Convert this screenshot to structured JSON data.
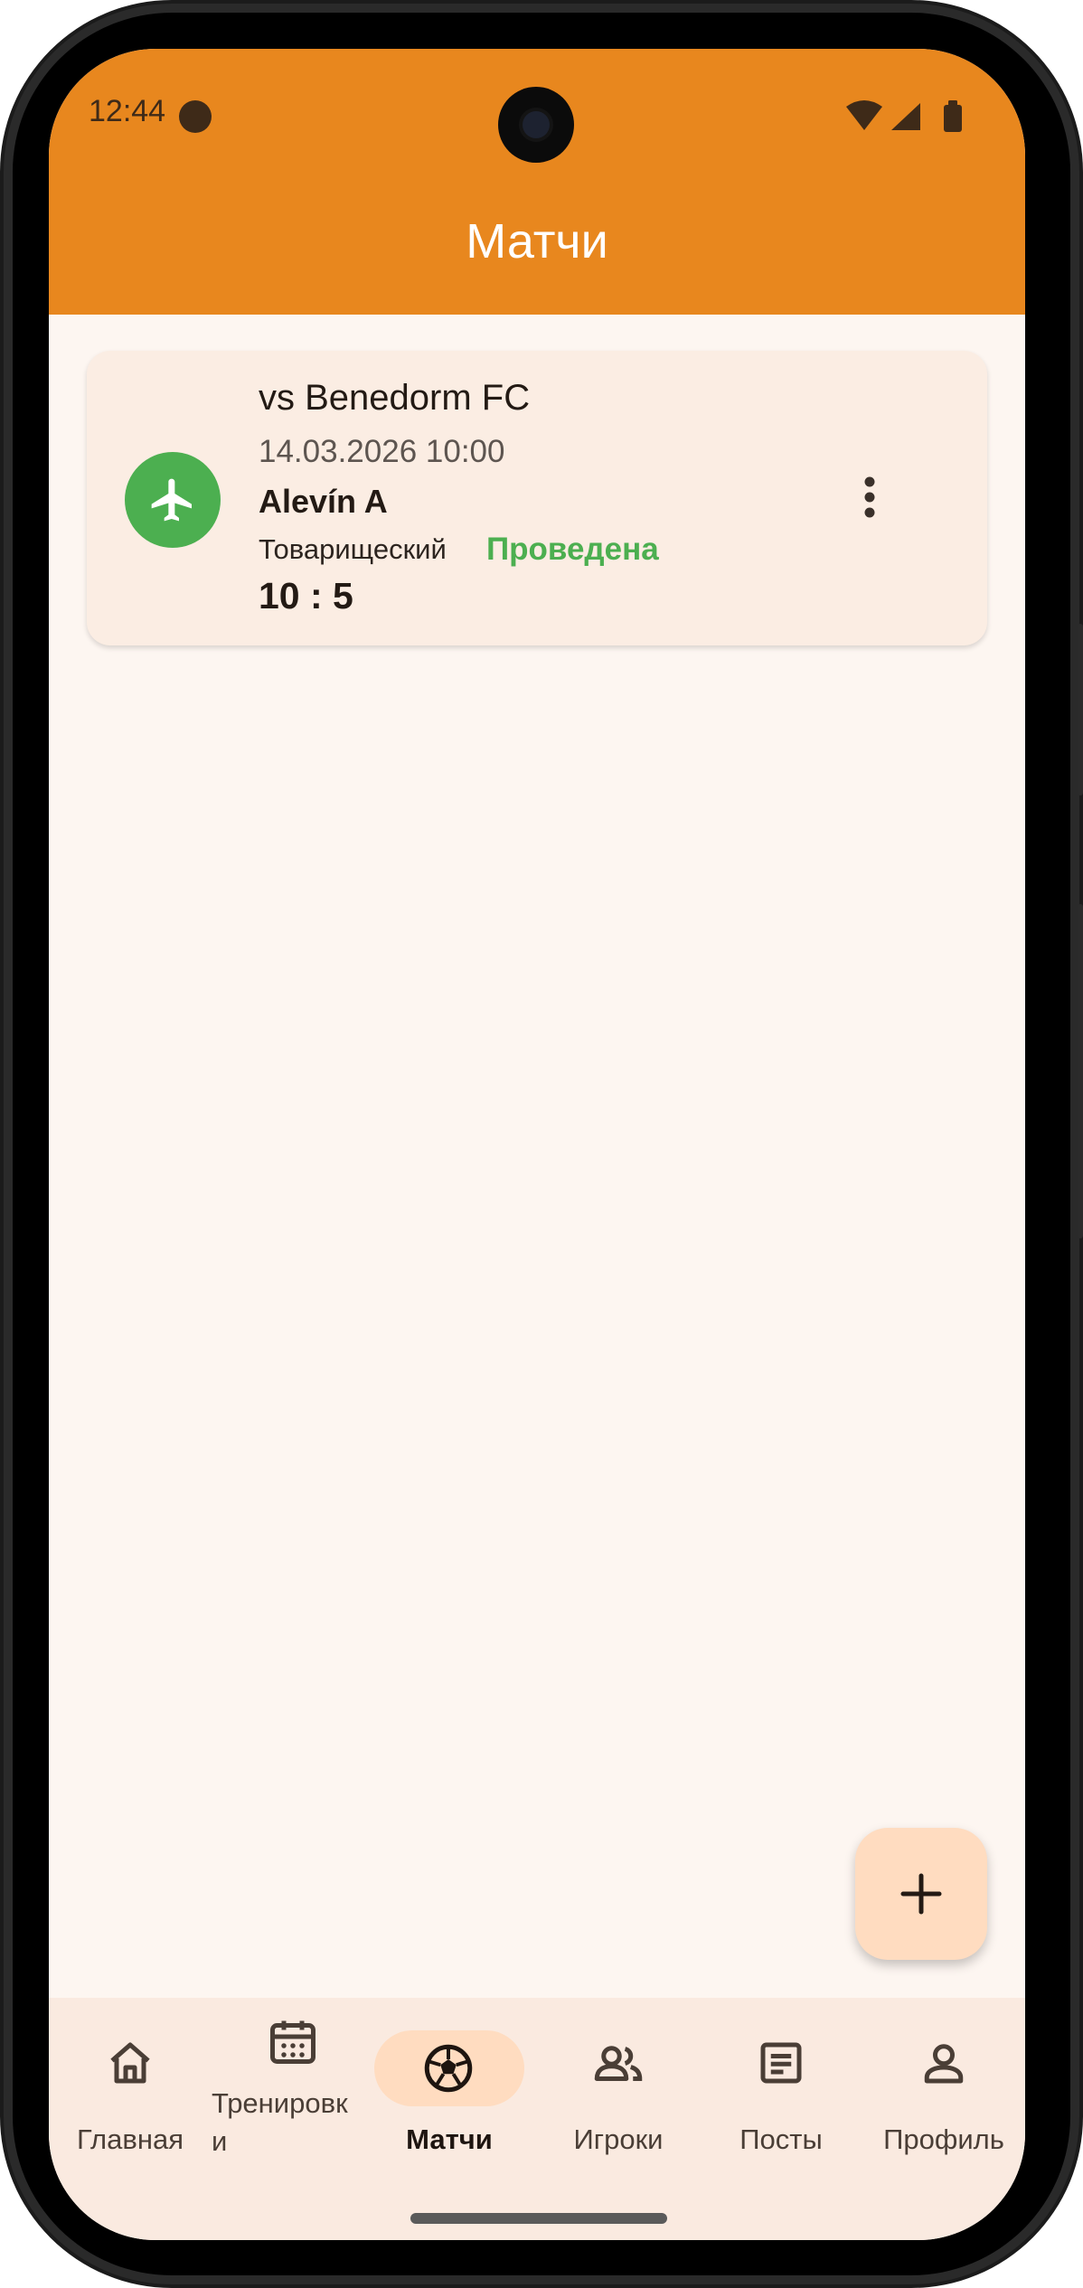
{
  "status_bar": {
    "time": "12:44"
  },
  "app_bar": {
    "title": "Матчи"
  },
  "matches": [
    {
      "opponent": "vs Benedorm FC",
      "datetime": "14.03.2026 10:00",
      "team": "Alevín A",
      "type": "Товарищеский",
      "status": "Проведена",
      "score": "10 : 5",
      "icon": "airplane-icon"
    }
  ],
  "bottom_nav": {
    "items": [
      {
        "label": "Главная",
        "icon": "home-icon"
      },
      {
        "label": "Тренировк\nи",
        "icon": "calendar-icon"
      },
      {
        "label": "Матчи",
        "icon": "soccer-ball-icon",
        "active": true
      },
      {
        "label": "Игроки",
        "icon": "people-icon"
      },
      {
        "label": "Посты",
        "icon": "article-icon"
      },
      {
        "label": "Профиль",
        "icon": "person-icon"
      }
    ]
  },
  "colors": {
    "app_bar": "#E8871E",
    "background": "#FDF6F1",
    "card": "#FBEDE3",
    "status_green": "#4CAF50",
    "accent_light": "#FFDCC0",
    "nav_bar": "#FAEAE0"
  }
}
